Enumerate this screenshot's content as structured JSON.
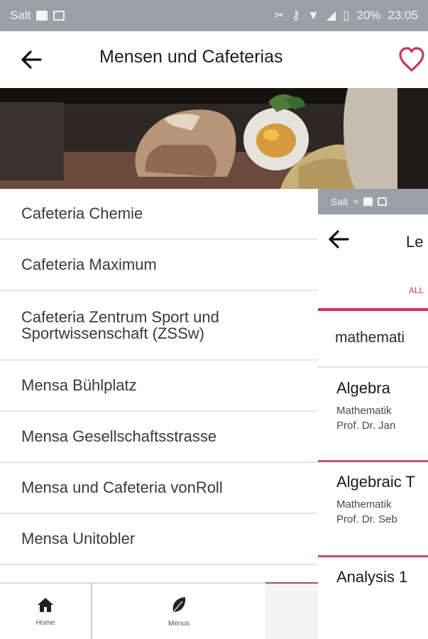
{
  "status_bar": {
    "carrier": "Salt",
    "battery": "20%",
    "time": "23:05"
  },
  "header": {
    "title": "Mensen und Cafeterias"
  },
  "cafeterias": [
    "Cafeteria Chemie",
    "Cafeteria Maximum",
    "Cafeteria Zentrum Sport und Sportwissenschaft (ZSSw)",
    "Mensa Bühlplatz",
    "Mensa Gesellschaftsstrasse",
    "Mensa und Cafeteria vonRoll",
    "Mensa Unitobler"
  ],
  "bottom_nav": {
    "home_label": "Home",
    "menus_label": "Menus"
  },
  "overlay": {
    "status_carrier": "Salt",
    "title": "Le",
    "tab": "ALL",
    "search_text": "mathemati",
    "courses": [
      {
        "title": "Algebra",
        "dept": "Mathematik",
        "prof": "Prof. Dr. Jan"
      },
      {
        "title": "Algebraic T",
        "dept": "Mathematik",
        "prof": "Prof. Dr. Seb"
      },
      {
        "title": "Analysis 1",
        "dept": "",
        "prof": ""
      }
    ]
  },
  "colors": {
    "accent": "#c0395a",
    "status_bar": "#9aa0a6"
  }
}
